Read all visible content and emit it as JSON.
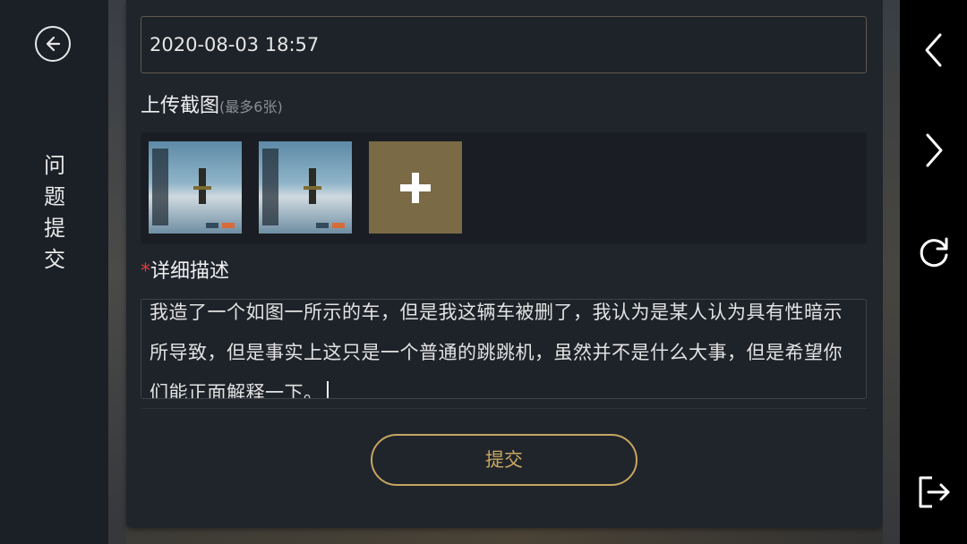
{
  "sidebar": {
    "back_icon": "arrow-left-circle-icon",
    "title_chars": [
      "问",
      "题",
      "提",
      "交"
    ]
  },
  "form": {
    "datetime_value": "2020-08-03 18:57",
    "upload_label": "上传截图",
    "upload_hint": "(最多6张)",
    "add_icon": "plus-icon",
    "required_mark": "*",
    "description_label": "详细描述",
    "description_value": "我造了一个如图一所示的车，但是我这辆车被删了，我认为是某人认为具有性暗示所导致，但是事实上这只是一个普通的跳跳机，虽然并不是什么大事，但是希望你们能正面解释一下。",
    "submit_label": "提交"
  },
  "right_nav": {
    "icons": [
      "chevron-left-icon",
      "chevron-right-icon",
      "refresh-icon",
      "exit-icon"
    ]
  },
  "colors": {
    "accent_gold": "#c6a660",
    "required_red": "#e03a3a",
    "panel_bg": "#20252c",
    "sidebar_bg": "#1b2027"
  }
}
